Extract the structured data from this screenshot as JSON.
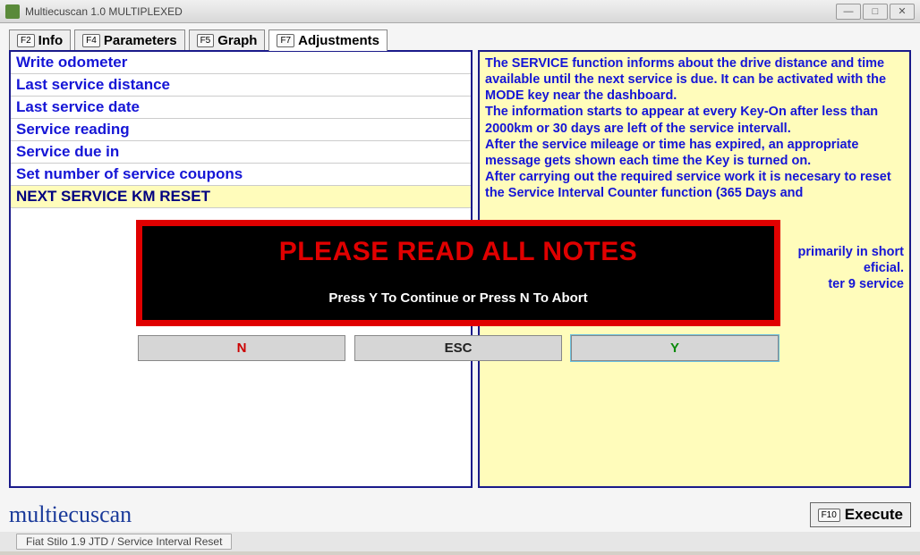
{
  "window": {
    "title": "Multiecuscan 1.0 MULTIPLEXED",
    "title_dim": ""
  },
  "tabs": {
    "info": {
      "fkey": "F2",
      "label": "Info"
    },
    "parameters": {
      "fkey": "F4",
      "label": "Parameters"
    },
    "graph": {
      "fkey": "F5",
      "label": "Graph"
    },
    "adjustments": {
      "fkey": "F7",
      "label": "Adjustments"
    }
  },
  "list": {
    "items": [
      "Write odometer",
      "Last service distance",
      "Last service date",
      "Service reading",
      "Service due in",
      "Set number of service coupons",
      "NEXT SERVICE KM RESET"
    ],
    "selected_index": 6
  },
  "info_text": {
    "p1": "The SERVICE function informs about the drive distance and time available until the next service is due. It can be activated with the MODE key near the dashboard.",
    "p2": "The information starts to appear at every Key-On after less than 2000km or 30 days are left of the service intervall.",
    "p3": "After the service mileage or time has expired, an appropriate message gets shown each time the Key is turned on.",
    "p4": "After carrying out the required service work it is necesary to reset the Service Interval Counter function (365 Days and",
    "p5_tail_a": "primarily in short",
    "p5_tail_b": "eficial.",
    "p5_tail_c": "ter 9 service"
  },
  "footer": {
    "brand": "multiecuscan",
    "execute_fkey": "F10",
    "execute_label": "Execute"
  },
  "status": {
    "text": "Fiat Stilo 1.9 JTD / Service Interval Reset"
  },
  "modal": {
    "title": "PLEASE READ ALL NOTES",
    "subtitle": "Press Y To Continue or Press N To Abort",
    "btn_n": "N",
    "btn_esc": "ESC",
    "btn_y": "Y"
  }
}
